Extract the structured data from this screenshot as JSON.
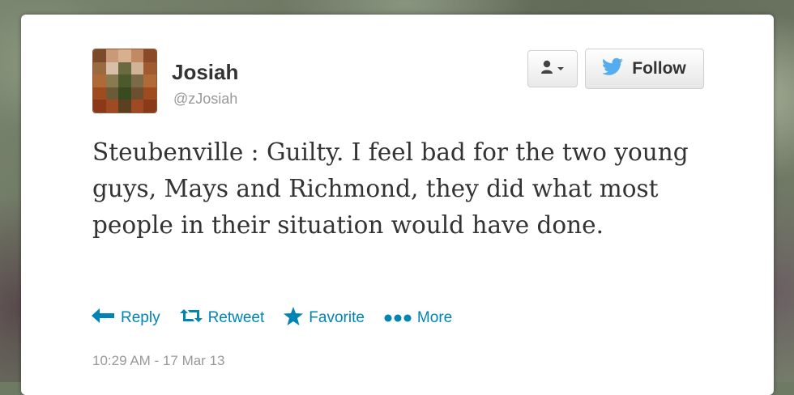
{
  "user": {
    "name": "Josiah",
    "handle": "@zJosiah"
  },
  "header": {
    "follow_label": "Follow",
    "user_dropdown_icon": "user-dropdown-icon",
    "bird_icon": "twitter-bird-icon"
  },
  "tweet": {
    "text": "Steubenville : Guilty. I feel bad for the two young guys, Mays and Richmond, they did what most people in their situation would have done.",
    "timestamp": "10:29 AM - 17 Mar 13"
  },
  "actions": {
    "reply": "Reply",
    "retweet": "Retweet",
    "favorite": "Favorite",
    "more": "More"
  },
  "colors": {
    "link": "#0084b4",
    "muted": "#999999",
    "text": "#333333"
  }
}
